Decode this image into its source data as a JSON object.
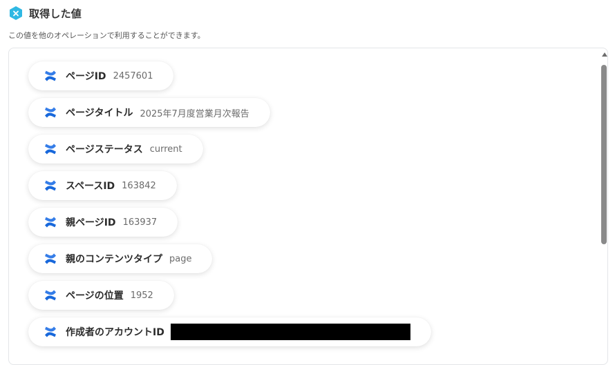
{
  "header": {
    "title": "取得した値",
    "subtitle": "この値を他のオペレーションで利用することができます。",
    "badge_color": "#2fb8e3"
  },
  "items": [
    {
      "label": "ページID",
      "value": "2457601",
      "icon": "confluence-icon"
    },
    {
      "label": "ページタイトル",
      "value": "2025年7月度営業月次報告",
      "icon": "confluence-icon"
    },
    {
      "label": "ページステータス",
      "value": "current",
      "icon": "confluence-icon"
    },
    {
      "label": "スペースID",
      "value": "163842",
      "icon": "confluence-icon"
    },
    {
      "label": "親ページID",
      "value": "163937",
      "icon": "confluence-icon"
    },
    {
      "label": "親のコンテンツタイプ",
      "value": "page",
      "icon": "confluence-icon"
    },
    {
      "label": "ページの位置",
      "value": "1952",
      "icon": "confluence-icon"
    },
    {
      "label": "作成者のアカウントID",
      "value": "",
      "icon": "confluence-icon",
      "redacted": true
    }
  ],
  "colors": {
    "icon_blue": "#1868db",
    "icon_blue_light": "#357de8"
  }
}
